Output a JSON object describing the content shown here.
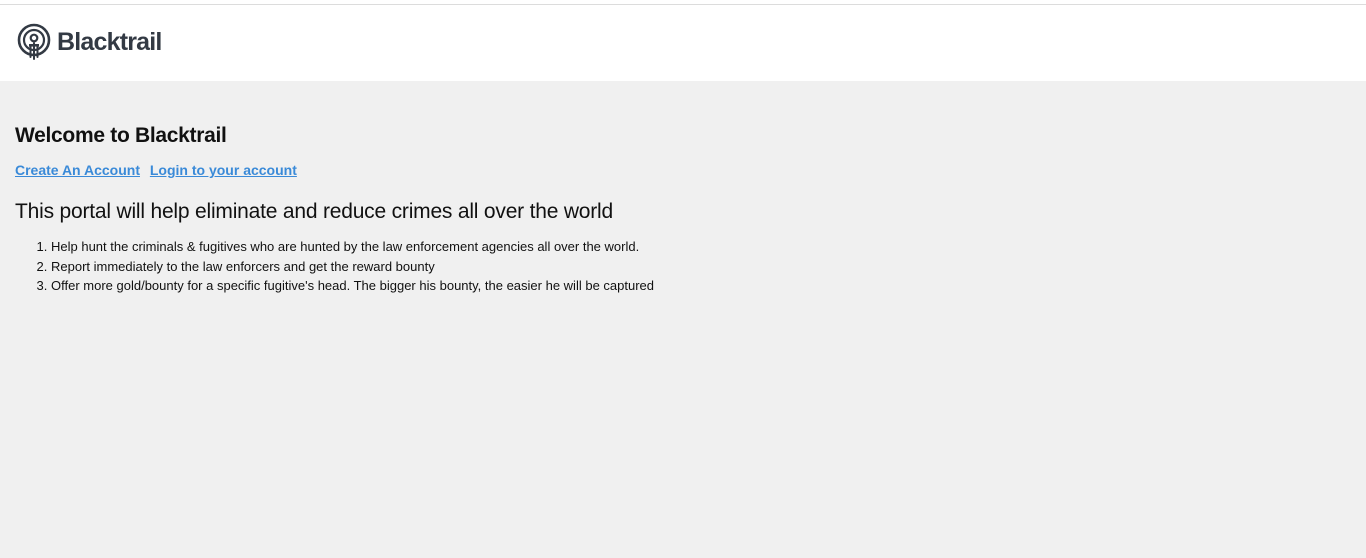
{
  "brand": {
    "name": "Blacktrail",
    "icon": "fingerprint-pin-icon",
    "color": "#333a44"
  },
  "main": {
    "welcome_title": "Welcome to Blacktrail",
    "links": {
      "create_account": "Create An Account",
      "login": "Login to your account"
    },
    "tagline": "This portal will help eliminate and reduce crimes all over the world",
    "features": [
      "Help hunt the criminals & fugitives who are hunted by the law enforcement agencies all over the world.",
      "Report immediately to the law enforcers and get the reward bounty",
      "Offer more gold/bounty for a specific fugitive's head. The bigger his bounty, the easier he will be captured"
    ]
  },
  "colors": {
    "background": "#f0f0f0",
    "header_background": "#ffffff",
    "link": "#3a8ad8"
  }
}
